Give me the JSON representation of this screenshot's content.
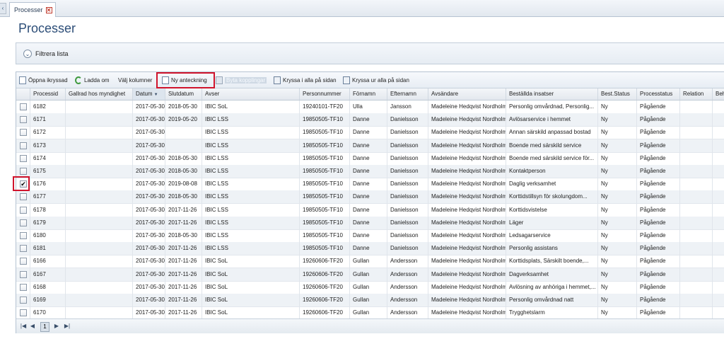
{
  "tab": {
    "label": "Processer",
    "close": "✕"
  },
  "page_title": "Processer",
  "filter": {
    "label": "Filtrera lista",
    "chevron": "⌄"
  },
  "toolbar": {
    "open_checked": "Öppna ikryssad",
    "reload": "Ladda om",
    "choose_columns": "Välj kolumner",
    "new_note": "Ny anteckning",
    "change_links": "Byta kopplingar",
    "check_all": "Kryssa i alla på sidan",
    "uncheck_all": "Kryssa ur alla på sidan"
  },
  "columns": [
    "Processid",
    "Gallrad hos myndighet",
    "Datum",
    "Slutdatum",
    "Avser",
    "Personnummer",
    "Förnamn",
    "Efternamn",
    "Avsändare",
    "Beställda insatser",
    "Best.Status",
    "Processtatus",
    "Relation",
    "Behö"
  ],
  "rows": [
    {
      "checked": false,
      "id": "6182",
      "gallrad": "",
      "datum": "2017-05-30",
      "slut": "2018-05-30",
      "avser": "IBIC SoL",
      "pnr": "19240101-TF20",
      "fn": "Ulla",
      "en": "Jansson",
      "avs": "Madeleine Hedqvist Nordholm",
      "ins": "Personlig omvårdnad, Personlig...",
      "bs": "Ny",
      "ps": "Pågående"
    },
    {
      "checked": false,
      "id": "6171",
      "gallrad": "",
      "datum": "2017-05-30",
      "slut": "2019-05-20",
      "avser": "IBIC LSS",
      "pnr": "19850505-TF10",
      "fn": "Danne",
      "en": "Danielsson",
      "avs": "Madeleine Hedqvist Nordholm",
      "ins": "Avlösarservice i hemmet",
      "bs": "Ny",
      "ps": "Pågående"
    },
    {
      "checked": false,
      "id": "6172",
      "gallrad": "",
      "datum": "2017-05-30",
      "slut": "",
      "avser": "IBIC LSS",
      "pnr": "19850505-TF10",
      "fn": "Danne",
      "en": "Danielsson",
      "avs": "Madeleine Hedqvist Nordholm",
      "ins": "Annan särskild anpassad bostad",
      "bs": "Ny",
      "ps": "Pågående"
    },
    {
      "checked": false,
      "id": "6173",
      "gallrad": "",
      "datum": "2017-05-30",
      "slut": "",
      "avser": "IBIC LSS",
      "pnr": "19850505-TF10",
      "fn": "Danne",
      "en": "Danielsson",
      "avs": "Madeleine Hedqvist Nordholm",
      "ins": "Boende med särskild service",
      "bs": "Ny",
      "ps": "Pågående"
    },
    {
      "checked": false,
      "id": "6174",
      "gallrad": "",
      "datum": "2017-05-30",
      "slut": "2018-05-30",
      "avser": "IBIC LSS",
      "pnr": "19850505-TF10",
      "fn": "Danne",
      "en": "Danielsson",
      "avs": "Madeleine Hedqvist Nordholm",
      "ins": "Boende med särskild service för...",
      "bs": "Ny",
      "ps": "Pågående"
    },
    {
      "checked": false,
      "id": "6175",
      "gallrad": "",
      "datum": "2017-05-30",
      "slut": "2018-05-30",
      "avser": "IBIC LSS",
      "pnr": "19850505-TF10",
      "fn": "Danne",
      "en": "Danielsson",
      "avs": "Madeleine Hedqvist Nordholm",
      "ins": "Kontaktperson",
      "bs": "Ny",
      "ps": "Pågående"
    },
    {
      "checked": true,
      "id": "6176",
      "gallrad": "",
      "datum": "2017-05-30",
      "slut": "2019-08-08",
      "avser": "IBIC LSS",
      "pnr": "19850505-TF10",
      "fn": "Danne",
      "en": "Danielsson",
      "avs": "Madeleine Hedqvist Nordholm",
      "ins": "Daglig verksamhet",
      "bs": "Ny",
      "ps": "Pågående"
    },
    {
      "checked": false,
      "id": "6177",
      "gallrad": "",
      "datum": "2017-05-30",
      "slut": "2018-05-30",
      "avser": "IBIC LSS",
      "pnr": "19850505-TF10",
      "fn": "Danne",
      "en": "Danielsson",
      "avs": "Madeleine Hedqvist Nordholm",
      "ins": "Korttidstillsyn för skolungdom...",
      "bs": "Ny",
      "ps": "Pågående"
    },
    {
      "checked": false,
      "id": "6178",
      "gallrad": "",
      "datum": "2017-05-30",
      "slut": "2017-11-26",
      "avser": "IBIC LSS",
      "pnr": "19850505-TF10",
      "fn": "Danne",
      "en": "Danielsson",
      "avs": "Madeleine Hedqvist Nordholm",
      "ins": "Korttidsvistelse",
      "bs": "Ny",
      "ps": "Pågående"
    },
    {
      "checked": false,
      "id": "6179",
      "gallrad": "",
      "datum": "2017-05-30",
      "slut": "2017-11-26",
      "avser": "IBIC LSS",
      "pnr": "19850505-TF10",
      "fn": "Danne",
      "en": "Danielsson",
      "avs": "Madeleine Hedqvist Nordholm",
      "ins": "Läger",
      "bs": "Ny",
      "ps": "Pågående"
    },
    {
      "checked": false,
      "id": "6180",
      "gallrad": "",
      "datum": "2017-05-30",
      "slut": "2018-05-30",
      "avser": "IBIC LSS",
      "pnr": "19850505-TF10",
      "fn": "Danne",
      "en": "Danielsson",
      "avs": "Madeleine Hedqvist Nordholm",
      "ins": "Ledsagarservice",
      "bs": "Ny",
      "ps": "Pågående"
    },
    {
      "checked": false,
      "id": "6181",
      "gallrad": "",
      "datum": "2017-05-30",
      "slut": "2017-11-26",
      "avser": "IBIC LSS",
      "pnr": "19850505-TF10",
      "fn": "Danne",
      "en": "Danielsson",
      "avs": "Madeleine Hedqvist Nordholm",
      "ins": "Personlig assistans",
      "bs": "Ny",
      "ps": "Pågående"
    },
    {
      "checked": false,
      "id": "6166",
      "gallrad": "",
      "datum": "2017-05-30",
      "slut": "2017-11-26",
      "avser": "IBIC SoL",
      "pnr": "19260606-TF20",
      "fn": "Gullan",
      "en": "Andersson",
      "avs": "Madeleine Hedqvist Nordholm",
      "ins": "Korttidsplats, Särskilt boende,...",
      "bs": "Ny",
      "ps": "Pågående"
    },
    {
      "checked": false,
      "id": "6167",
      "gallrad": "",
      "datum": "2017-05-30",
      "slut": "2017-11-26",
      "avser": "IBIC SoL",
      "pnr": "19260606-TF20",
      "fn": "Gullan",
      "en": "Andersson",
      "avs": "Madeleine Hedqvist Nordholm",
      "ins": "Dagverksamhet",
      "bs": "Ny",
      "ps": "Pågående"
    },
    {
      "checked": false,
      "id": "6168",
      "gallrad": "",
      "datum": "2017-05-30",
      "slut": "2017-11-26",
      "avser": "IBIC SoL",
      "pnr": "19260606-TF20",
      "fn": "Gullan",
      "en": "Andersson",
      "avs": "Madeleine Hedqvist Nordholm",
      "ins": "Avlösning av anhöriga i hemmet,...",
      "bs": "Ny",
      "ps": "Pågående"
    },
    {
      "checked": false,
      "id": "6169",
      "gallrad": "",
      "datum": "2017-05-30",
      "slut": "2017-11-26",
      "avser": "IBIC SoL",
      "pnr": "19260606-TF20",
      "fn": "Gullan",
      "en": "Andersson",
      "avs": "Madeleine Hedqvist Nordholm",
      "ins": "Personlig omvårdnad natt",
      "bs": "Ny",
      "ps": "Pågående"
    },
    {
      "checked": false,
      "id": "6170",
      "gallrad": "",
      "datum": "2017-05-30",
      "slut": "2017-11-26",
      "avser": "IBIC SoL",
      "pnr": "19260606-TF20",
      "fn": "Gullan",
      "en": "Andersson",
      "avs": "Madeleine Hedqvist Nordholm",
      "ins": "Trygghetslarm",
      "bs": "Ny",
      "ps": "Pågående"
    }
  ],
  "pager": {
    "first": "|◀",
    "prev": "◀",
    "page": "1",
    "next": "▶",
    "last": "▶|"
  },
  "colors": {
    "title": "#2d4e78",
    "highlight": "#d0142c"
  }
}
